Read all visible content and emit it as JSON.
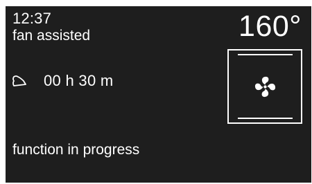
{
  "status_bar": {
    "time": "12:37",
    "mode": "fan assisted"
  },
  "temperature": {
    "value": "160°"
  },
  "timer": {
    "icon": "bell-icon",
    "duration": "00 h 30 m"
  },
  "function_box": {
    "icon": "fan-icon"
  },
  "status": {
    "text": "function in progress"
  },
  "colors": {
    "background": "#1e1e1e",
    "foreground": "#ffffff"
  }
}
